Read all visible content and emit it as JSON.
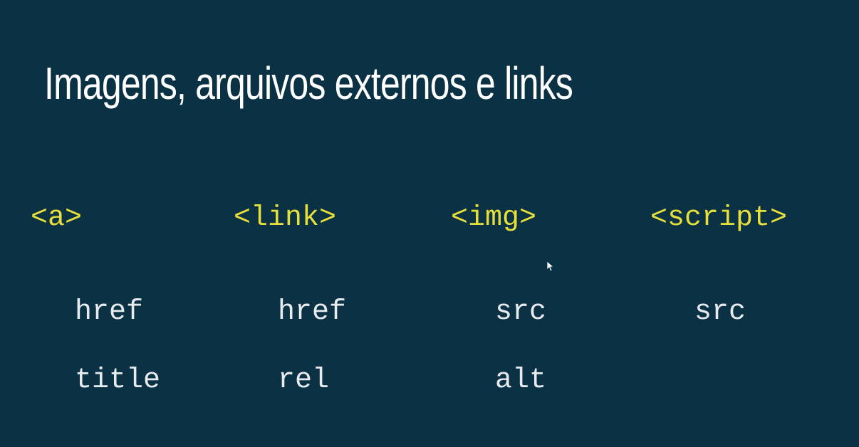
{
  "slide": {
    "title": "Imagens, arquivos externos e links",
    "columns": [
      {
        "tag": "<a>",
        "attributes": [
          "href",
          "title"
        ]
      },
      {
        "tag": "<link>",
        "attributes": [
          "href",
          "rel"
        ]
      },
      {
        "tag": "<img>",
        "attributes": [
          "src",
          "alt"
        ]
      },
      {
        "tag": "<script>",
        "attributes": [
          "src"
        ]
      }
    ]
  },
  "colors": {
    "background": "#0b3145",
    "title": "#ffffff",
    "tag": "#e7df3a",
    "attribute": "#e8ebee"
  }
}
